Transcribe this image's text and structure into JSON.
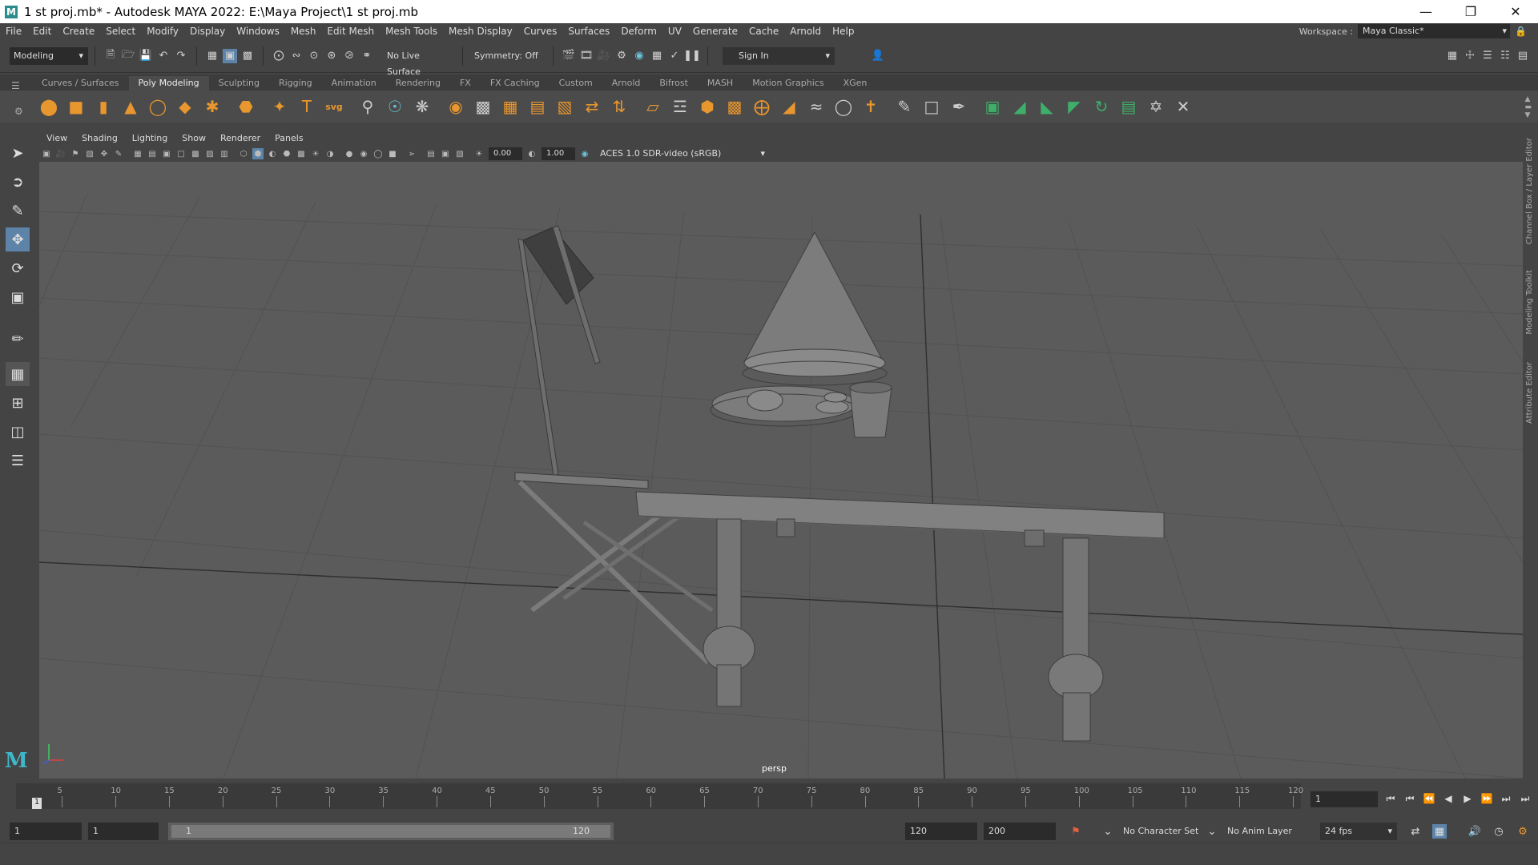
{
  "window": {
    "title": "1 st proj.mb* - Autodesk MAYA 2022: E:\\Maya Project\\1 st proj.mb",
    "app_icon": "M"
  },
  "menus": [
    "File",
    "Edit",
    "Create",
    "Select",
    "Modify",
    "Display",
    "Windows",
    "Mesh",
    "Edit Mesh",
    "Mesh Tools",
    "Mesh Display",
    "Curves",
    "Surfaces",
    "Deform",
    "UV",
    "Generate",
    "Cache",
    "Arnold",
    "Help"
  ],
  "workspace": {
    "label": "Workspace :",
    "value": "Maya Classic*"
  },
  "status_line": {
    "mode": "Modeling",
    "live_surface": "No Live Surface",
    "symmetry": "Symmetry: Off",
    "sign_in": "Sign In"
  },
  "shelf_tabs": [
    "Curves / Surfaces",
    "Poly Modeling",
    "Sculpting",
    "Rigging",
    "Animation",
    "Rendering",
    "FX",
    "FX Caching",
    "Custom",
    "Arnold",
    "Bifrost",
    "MASH",
    "Motion Graphics",
    "XGen"
  ],
  "shelf_active": "Poly Modeling",
  "panel_menu": [
    "View",
    "Shading",
    "Lighting",
    "Show",
    "Renderer",
    "Panels"
  ],
  "panel_toolbar": {
    "exposure": "0.00",
    "gamma": "1.00",
    "color_space": "ACES 1.0 SDR-video (sRGB)"
  },
  "viewport": {
    "camera": "persp"
  },
  "side_tabs": [
    "Channel Box / Layer Editor",
    "Modeling Toolkit",
    "Attribute Editor"
  ],
  "timeline": {
    "ticks": [
      "5",
      "10",
      "15",
      "20",
      "25",
      "30",
      "35",
      "40",
      "45",
      "50",
      "55",
      "60",
      "65",
      "70",
      "75",
      "80",
      "85",
      "90",
      "95",
      "100",
      "105",
      "110",
      "115",
      "120"
    ],
    "current_marker": "1",
    "current_frame": "1"
  },
  "range": {
    "start": "1",
    "playback_start": "1",
    "slider_start": "1",
    "slider_end": "120",
    "playback_end": "120",
    "end": "200",
    "character_set": "No Character Set",
    "anim_layer": "No Anim Layer",
    "fps": "24 fps"
  },
  "colors": {
    "accent": "#5d84a8",
    "shelf_orange": "#e8962e",
    "shelf_green": "#3fae6a",
    "logo": "#3fb7c9"
  }
}
